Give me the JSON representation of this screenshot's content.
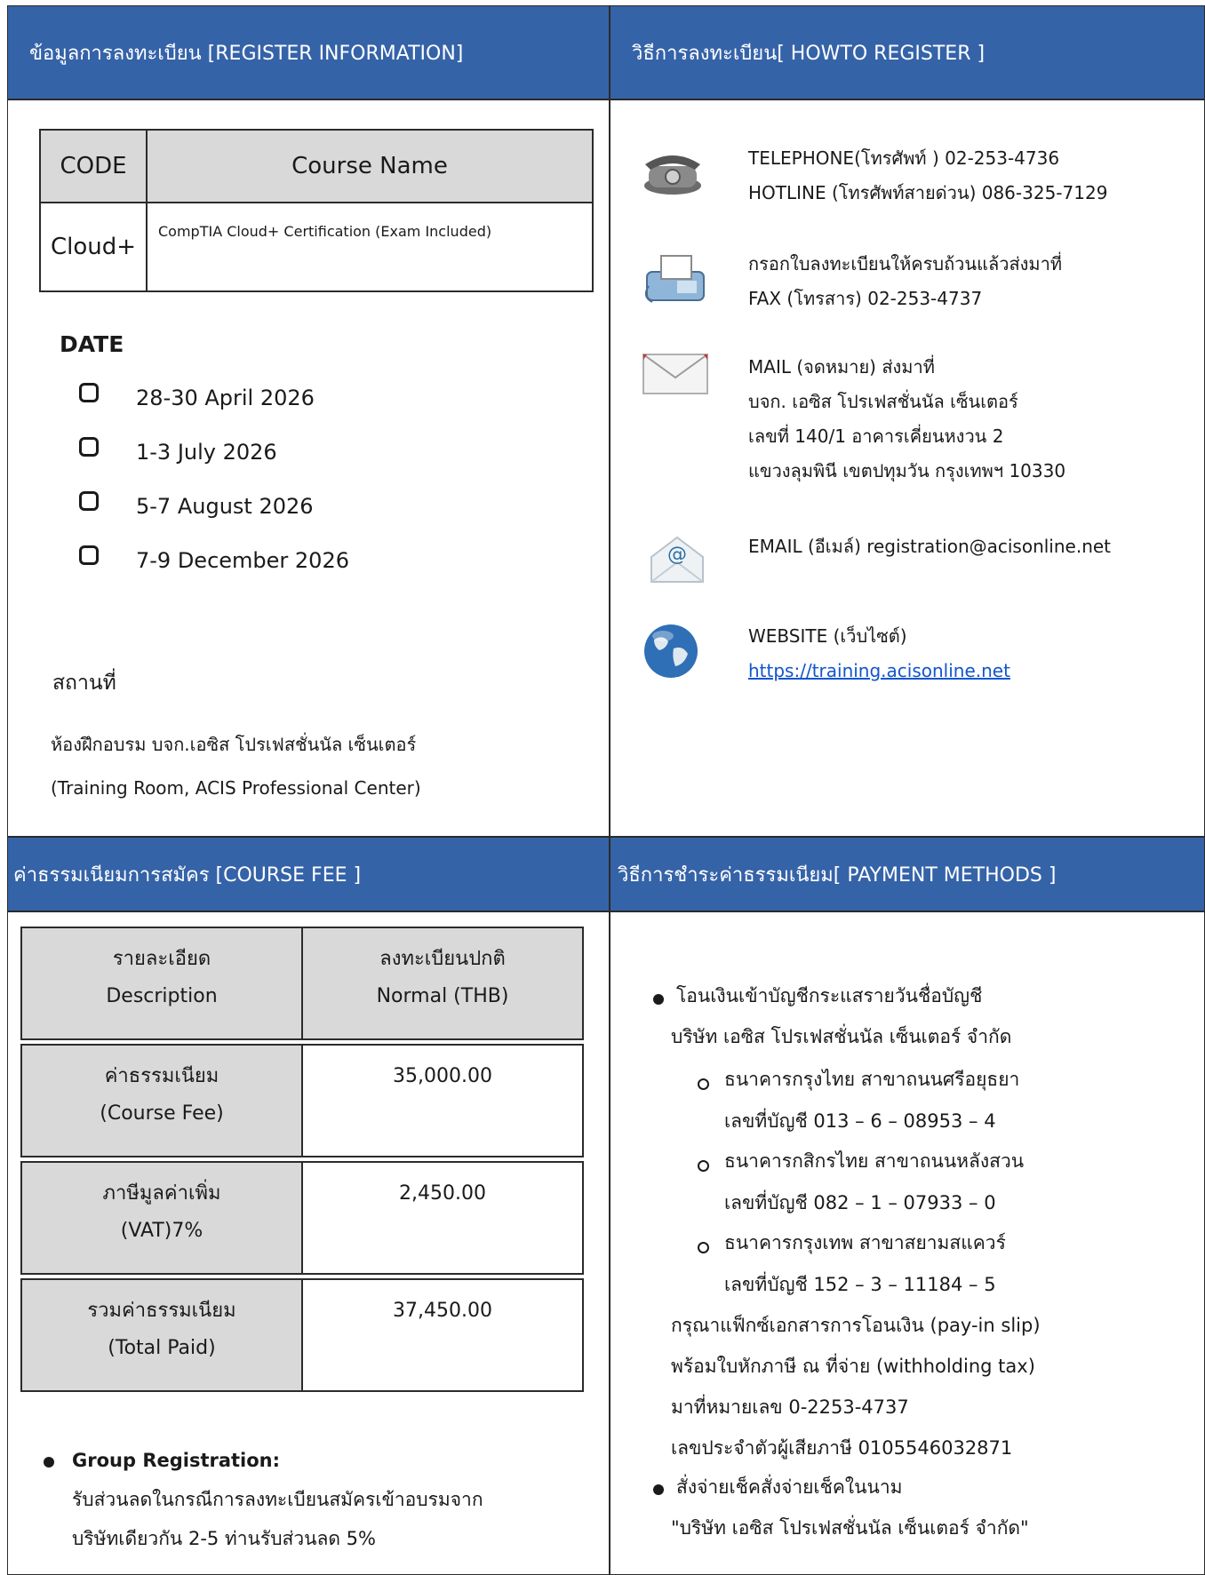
{
  "register": {
    "header": "ข้อมูลการลงทะเบียน [REGISTER INFORMATION]",
    "table": {
      "col_code": "CODE",
      "col_name": "Course Name",
      "code": "Cloud+",
      "name": "CompTIA Cloud+ Certification (Exam Included)"
    },
    "date_label": "DATE",
    "dates": [
      "28-30 April 2026",
      "1-3 July 2026",
      "5-7 August 2026",
      "7-9 December 2026"
    ],
    "venue_label": "สถานที่",
    "venue_th": "ห้องฝึกอบรม บจก.เอซิส โปรเฟสชั่นนัล เซ็นเตอร์",
    "venue_en": "(Training Room, ACIS Professional Center)"
  },
  "howto": {
    "header": "วิธีการลงทะเบียน[ HOWTO REGISTER ]",
    "telephone": [
      "TELEPHONE(โทรศัพท์ ) 02-253-4736",
      "HOTLINE (โทรศัพท์สายด่วน) 086-325-7129"
    ],
    "fax": [
      "กรอกใบลงทะเบียนให้ครบถ้วนแล้วส่งมาที่",
      "FAX (โทรสาร) 02-253-4737"
    ],
    "mail": [
      "MAIL (จดหมาย) ส่งมาที่",
      "บจก. เอซิส โปรเฟสชั่นนัล เซ็นเตอร์",
      "เลขที่ 140/1 อาคารเคี่ยนหงวน 2",
      "แขวงลุมพินี เขตปทุมวัน กรุงเทพฯ 10330"
    ],
    "email": "EMAIL (อีเมล์) registration@acisonline.net",
    "website_label": "WEBSITE (เว็บไซต์)",
    "website_url": "https://training.acisonline.net"
  },
  "fee": {
    "header": "ค่าธรรมเนียมการสมัคร [COURSE FEE ]",
    "rows": [
      {
        "label": [
          "รายละเอียด",
          "Description"
        ],
        "value": [
          "ลงทะเบียนปกติ",
          "Normal (THB)"
        ]
      },
      {
        "label": [
          "ค่าธรรมเนียม",
          "(Course Fee)"
        ],
        "value": [
          "35,000.00"
        ]
      },
      {
        "label": [
          "ภาษีมูลค่าเพิ่ม",
          "(VAT)7%"
        ],
        "value": [
          "2,450.00"
        ]
      },
      {
        "label": [
          "รวมค่าธรรมเนียม",
          "(Total Paid)"
        ],
        "value": [
          "37,450.00"
        ]
      }
    ],
    "group_title": "Group Registration:",
    "group_lines": [
      "รับส่วนลดในกรณีการลงทะเบียนสมัครเข้าอบรมจาก",
      "บริษัทเดียวกัน 2-5 ท่านรับส่วนลด 5%"
    ]
  },
  "payment": {
    "header": "วิธีการชำระค่าธรรมเนียม[ PAYMENT METHODS ]",
    "transfer_title": "โอนเงินเข้าบัญชีกระแสรายวันชื่อบัญชี",
    "account_name": "บริษัท เอซิส โปรเฟสชั่นนัล เซ็นเตอร์ จำกัด",
    "banks": [
      {
        "name": "ธนาคารกรุงไทย สาขาถนนศรีอยุธยา",
        "acct": "เลขที่บัญชี 013 – 6 – 08953 – 4"
      },
      {
        "name": "ธนาคารกสิกรไทย สาขาถนนหลังสวน",
        "acct": "เลขที่บัญชี 082 – 1 – 07933 – 0"
      },
      {
        "name": "ธนาคารกรุงเทพ สาขาสยามสแควร์",
        "acct": "เลขที่บัญชี 152 – 3 – 11184 – 5"
      }
    ],
    "notes": [
      "กรุณาแฟ็กซ์เอกสารการโอนเงิน (pay-in slip)",
      "พร้อมใบหักภาษี ณ ที่จ่าย (withholding tax)",
      "มาที่หมายเลข  0-2253-4737",
      "เลขประจำตัวผู้เสียภาษี 0105546032871"
    ],
    "cheque_title": "สั่งจ่ายเช็คสั่งจ่ายเช็คในนาม",
    "cheque_payee": "\"บริษัท เอซิส โปรเฟสชั่นนัล เซ็นเตอร์ จำกัด\""
  }
}
